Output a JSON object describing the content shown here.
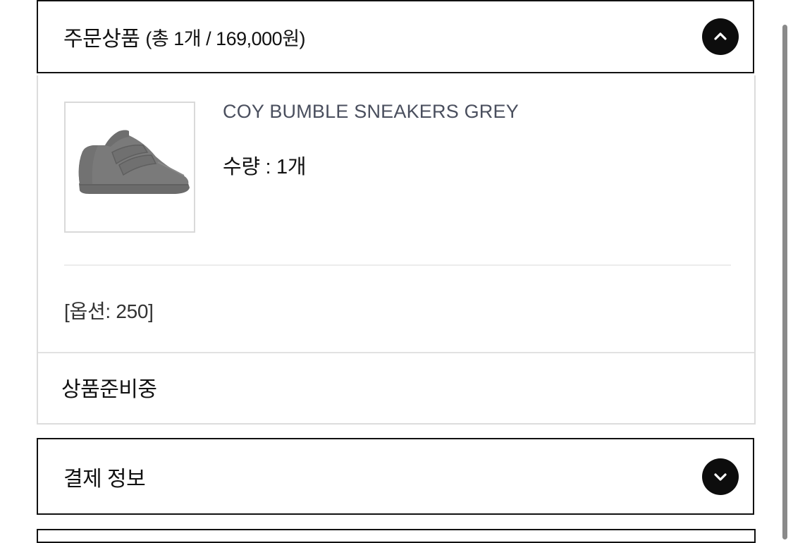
{
  "order_items": {
    "title": "주문상품",
    "summary": "(총 1개 / 169,000원)",
    "toggle_icon": "chevron-up-icon",
    "items": [
      {
        "name": "COY BUMBLE SNEAKERS GREY",
        "quantity": "수량 : 1개",
        "option": "[옵션: 250]",
        "thumbnail_icon": "grey-sneaker-image"
      }
    ],
    "status": "상품준비중"
  },
  "payment_info": {
    "title": "결제 정보",
    "toggle_icon": "chevron-down-icon"
  },
  "colors": {
    "border_dark": "#111111",
    "toggle_bg": "#0d0d0d",
    "product_name": "#4a4f5e",
    "divider": "#ececec"
  }
}
